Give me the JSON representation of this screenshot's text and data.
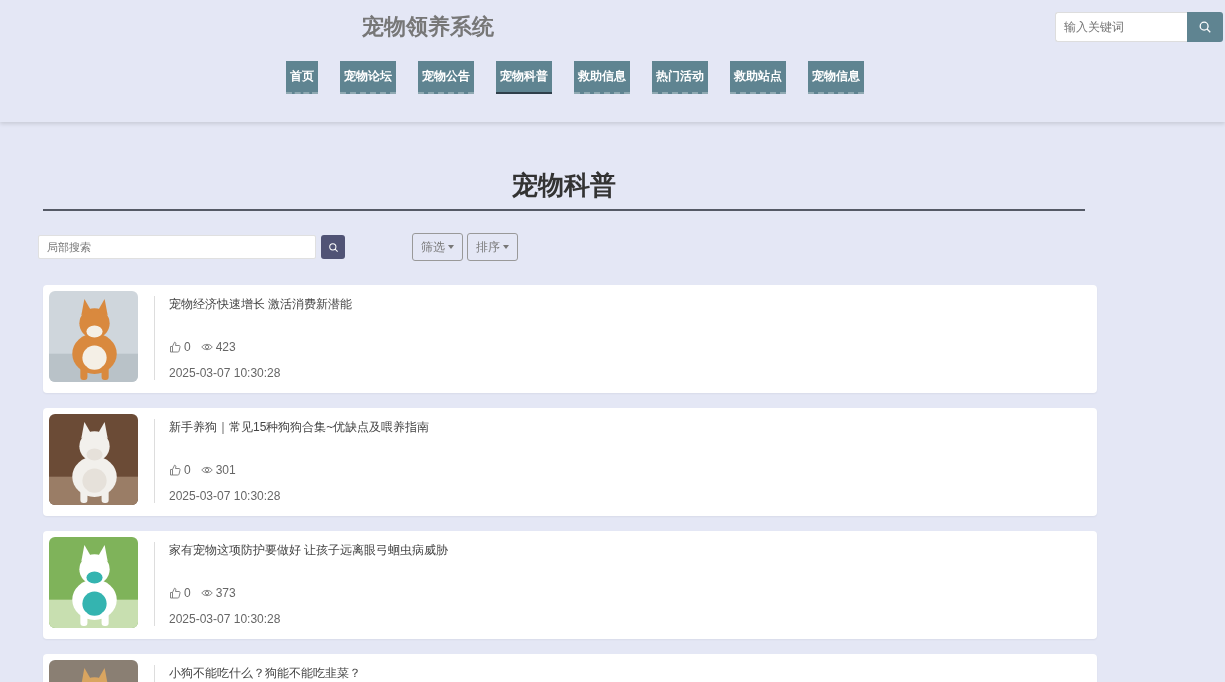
{
  "header": {
    "title": "宠物领养系统",
    "search": {
      "placeholder": "输入关键词"
    }
  },
  "nav": [
    {
      "label": "首页",
      "selected": false
    },
    {
      "label": "宠物论坛",
      "selected": false
    },
    {
      "label": "宠物公告",
      "selected": false
    },
    {
      "label": "宠物科普",
      "selected": true
    },
    {
      "label": "救助信息",
      "selected": false
    },
    {
      "label": "热门活动",
      "selected": false
    },
    {
      "label": "救助站点",
      "selected": false
    },
    {
      "label": "宠物信息",
      "selected": false
    }
  ],
  "page_title": "宠物科普",
  "toolbar": {
    "search": {
      "placeholder": "局部搜索"
    },
    "filter": "筛选",
    "sort": "排序"
  },
  "articles": [
    {
      "title": "宠物经济快速增长 激活消费新潜能",
      "likes": "0",
      "views": "423",
      "date": "2025-03-07 10:30:28"
    },
    {
      "title": "新手养狗｜常见15种狗狗合集~优缺点及喂养指南",
      "likes": "0",
      "views": "301",
      "date": "2025-03-07 10:30:28"
    },
    {
      "title": "家有宠物这项防护要做好 让孩子远离眼弓蛔虫病威胁",
      "likes": "0",
      "views": "373",
      "date": "2025-03-07 10:30:28"
    },
    {
      "title": "小狗不能吃什么？狗能不能吃韭菜？"
    }
  ]
}
